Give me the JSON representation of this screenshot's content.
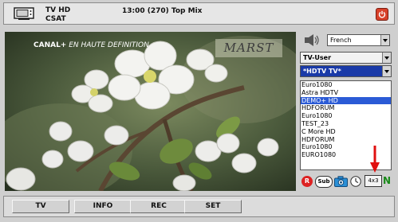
{
  "header": {
    "channel_name": "TV HD",
    "provider": "CSAT",
    "now_playing": "13:00 (270) Top Mix"
  },
  "video": {
    "overlay_brand": "CANAL+",
    "overlay_text": "EN HAUTE DEFINITION",
    "watermark": "MARST"
  },
  "panel": {
    "audio_language": "French",
    "user_profile": "TV-User",
    "channel_group": "*HDTV TV*",
    "channels": [
      {
        "name": "Euro1080",
        "selected": false
      },
      {
        "name": "Astra HDTV",
        "selected": false
      },
      {
        "name": "DEMO+ HD",
        "selected": true
      },
      {
        "name": "HDFORUM",
        "selected": false
      },
      {
        "name": "Euro1080",
        "selected": false
      },
      {
        "name": "TEST_23",
        "selected": false
      },
      {
        "name": "C More HD",
        "selected": false
      },
      {
        "name": "HDFORUM",
        "selected": false
      },
      {
        "name": "Euro1080",
        "selected": false
      },
      {
        "name": "EURO1080",
        "selected": false
      }
    ],
    "icons": {
      "record": "R",
      "subtitles": "Sub",
      "aspect": "4x3",
      "network": "N"
    }
  },
  "buttons": {
    "tv": "TV",
    "info": "INFO",
    "rec": "REC",
    "set": "SET"
  },
  "colors": {
    "selection": "#2b5bd6",
    "group_bg": "#1a3aa8",
    "power": "#d8412a",
    "annotation_arrow": "#e01010"
  }
}
